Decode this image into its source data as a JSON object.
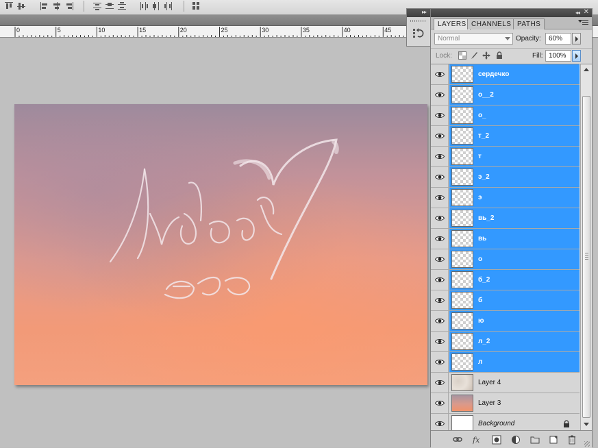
{
  "ruler": {
    "marks": [
      "0",
      "5",
      "10",
      "15",
      "20",
      "25",
      "30",
      "35",
      "40",
      "45"
    ]
  },
  "panel": {
    "tabs": [
      {
        "label": "LAYERS",
        "active": true
      },
      {
        "label": "CHANNELS",
        "active": false
      },
      {
        "label": "PATHS",
        "active": false
      }
    ],
    "blend_mode": "Normal",
    "opacity_label": "Opacity:",
    "opacity_value": "60%",
    "lock_label": "Lock:",
    "fill_label": "Fill:",
    "fill_value": "100%",
    "layers": [
      {
        "name": "сердечко",
        "selected": true,
        "thumb": "transparent"
      },
      {
        "name": "о__2",
        "selected": true,
        "thumb": "transparent"
      },
      {
        "name": "о_",
        "selected": true,
        "thumb": "transparent"
      },
      {
        "name": "т_2",
        "selected": true,
        "thumb": "transparent"
      },
      {
        "name": "т",
        "selected": true,
        "thumb": "transparent"
      },
      {
        "name": "э_2",
        "selected": true,
        "thumb": "transparent"
      },
      {
        "name": "э",
        "selected": true,
        "thumb": "transparent"
      },
      {
        "name": "вь_2",
        "selected": true,
        "thumb": "transparent"
      },
      {
        "name": "вь",
        "selected": true,
        "thumb": "transparent"
      },
      {
        "name": "о",
        "selected": true,
        "thumb": "transparent"
      },
      {
        "name": "б_2",
        "selected": true,
        "thumb": "transparent"
      },
      {
        "name": "б",
        "selected": true,
        "thumb": "transparent"
      },
      {
        "name": "ю",
        "selected": true,
        "thumb": "transparent"
      },
      {
        "name": "л_2",
        "selected": true,
        "thumb": "transparent"
      },
      {
        "name": "л",
        "selected": true,
        "thumb": "transparent"
      },
      {
        "name": "Layer 4",
        "selected": false,
        "thumb": "texture"
      },
      {
        "name": "Layer 3",
        "selected": false,
        "thumb": "sky"
      },
      {
        "name": "Background",
        "selected": false,
        "thumb": "white",
        "background": true
      }
    ]
  },
  "colors": {
    "selection": "#3399ff",
    "panel_bg": "#d6d6d6",
    "workspace": "#c0c0c0"
  }
}
